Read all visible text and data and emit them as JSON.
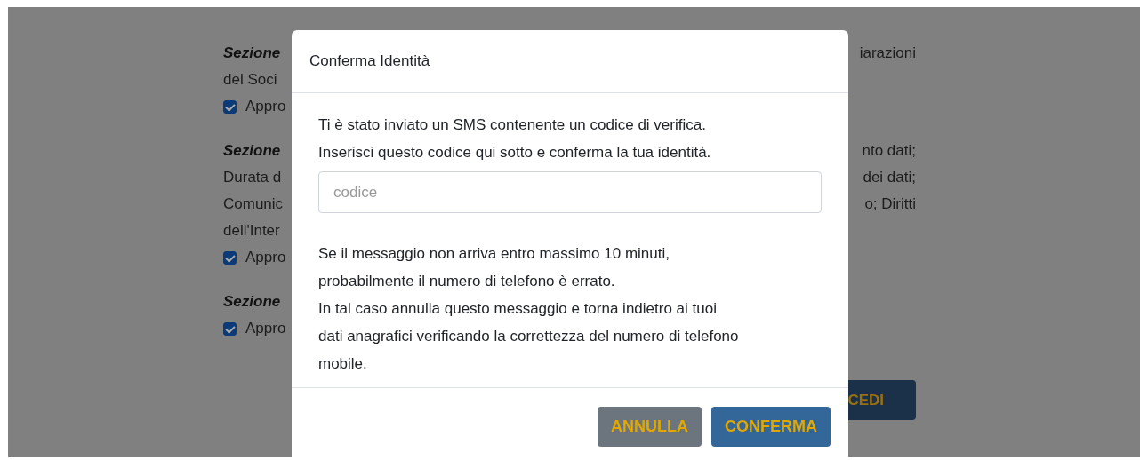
{
  "background": {
    "sections": [
      {
        "heading": "Sezione",
        "heading_right": "iarazioni",
        "lines": [
          {
            "left": "del Soci"
          }
        ],
        "approval": {
          "label": "Appro",
          "checked": true
        }
      },
      {
        "heading": "Sezione",
        "heading_right": "nto dati;",
        "lines": [
          {
            "left": "Durata d",
            "right": "dei dati;"
          },
          {
            "left": "Comunic",
            "right": "o; Diritti"
          },
          {
            "left": "dell'Inter"
          }
        ],
        "approval": {
          "label": "Appro",
          "checked": true
        }
      },
      {
        "heading": "Sezione",
        "approval": {
          "label": "Appro",
          "checked": true
        }
      }
    ],
    "proceed_button": "CEDI"
  },
  "dialog": {
    "title": "Conferma Identità",
    "intro_lines": [
      "Ti è stato inviato un SMS contenente un codice di verifica.",
      "Inserisci questo codice qui sotto e conferma la tua identità."
    ],
    "code_field": {
      "placeholder": "codice"
    },
    "note_lines": [
      "Se il messaggio non arriva entro massimo 10 minuti,",
      "probabilmente il numero di telefono è errato.",
      "In tal caso annulla questo messaggio e torna indietro ai tuoi",
      "dati anagrafici verificando la correttezza del numero di telefono",
      "mobile."
    ],
    "buttons": [
      {
        "kind": "secondary",
        "label": "ANNULLA"
      },
      {
        "kind": "primary",
        "label": "CONFERMA"
      }
    ]
  }
}
